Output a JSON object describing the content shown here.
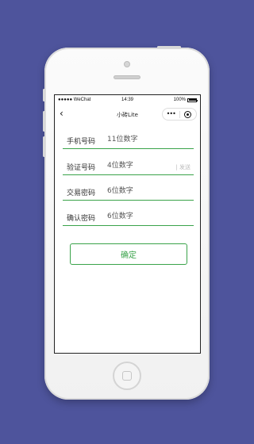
{
  "status": {
    "carrier": "●●●●● WeChat",
    "time": "14:39",
    "battery": "100%",
    "battery_level": 1.0
  },
  "nav": {
    "back": "‹",
    "title": "小砖Lite",
    "more": "•••"
  },
  "form": {
    "rows": [
      {
        "label": "手机号码",
        "placeholder": "11位数字"
      },
      {
        "label": "验证号码",
        "placeholder": "4位数字",
        "action": "| 发送"
      },
      {
        "label": "交易密码",
        "placeholder": "6位数字"
      },
      {
        "label": "确认密码",
        "placeholder": "6位数字"
      }
    ],
    "submit": "确定"
  },
  "colors": {
    "background": "#4e549c",
    "accent": "#3aa34a"
  }
}
